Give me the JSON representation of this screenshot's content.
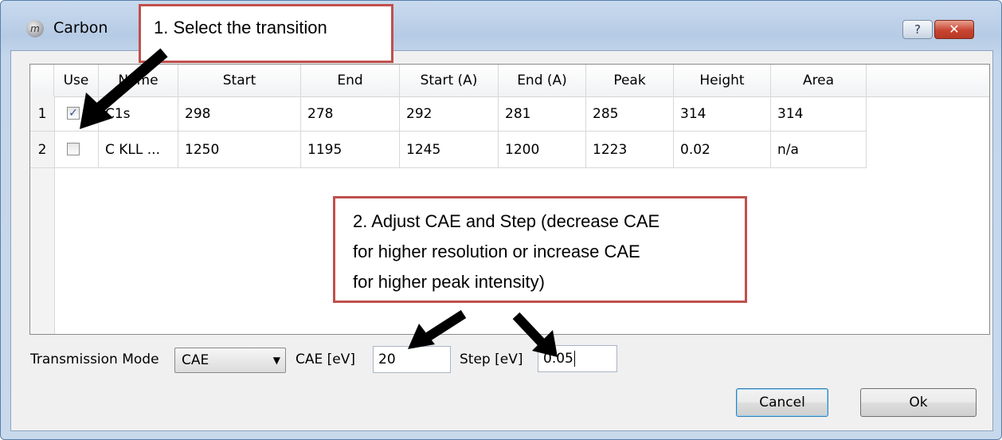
{
  "window": {
    "title": "Carbon",
    "help_glyph": "?",
    "close_glyph": "✕",
    "app_icon_glyph": "m"
  },
  "table": {
    "headers": [
      "Use",
      "Name",
      "Start",
      "End",
      "Start (A)",
      "End (A)",
      "Peak",
      "Height",
      "Area"
    ],
    "rows": [
      {
        "num": "1",
        "use": true,
        "name": "C1s",
        "start": "298",
        "end": "278",
        "start_a": "292",
        "end_a": "281",
        "peak": "285",
        "height": "314",
        "area": "314"
      },
      {
        "num": "2",
        "use": false,
        "name": "C KLL ...",
        "start": "1250",
        "end": "1195",
        "start_a": "1245",
        "end_a": "1200",
        "peak": "1223",
        "height": "0.02",
        "area": "n/a"
      }
    ]
  },
  "controls": {
    "transmission_mode_label": "Transmission Mode",
    "transmission_mode_value": "CAE",
    "cae_label": "CAE [eV]",
    "cae_value": "20",
    "step_label": "Step [eV]",
    "step_value": "0.05"
  },
  "buttons": {
    "cancel": "Cancel",
    "ok": "Ok"
  },
  "annotations": {
    "callout1": "1. Select the transition",
    "callout2_lines": [
      "2. Adjust CAE and Step (decrease CAE",
      "for higher resolution or increase CAE",
      "for higher peak intensity)"
    ]
  },
  "colors": {
    "callout_border": "#c0504d",
    "check": "#2a4f9a",
    "close_button": "#c74430"
  }
}
